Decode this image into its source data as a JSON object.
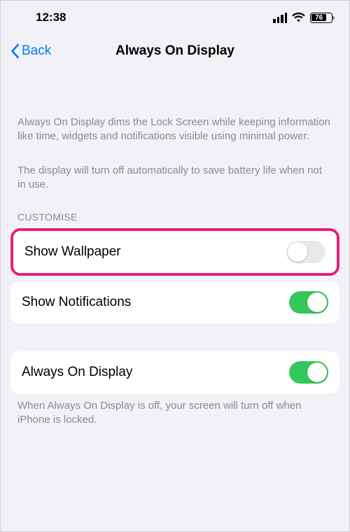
{
  "status": {
    "time": "12:38",
    "battery": "76"
  },
  "nav": {
    "back": "Back",
    "title": "Always On Display"
  },
  "description": {
    "p1": "Always On Display dims the Lock Screen while keeping information like time, widgets and notifications visible using minimal power.",
    "p2": "The display will turn off automatically to save battery life when not in use."
  },
  "sections": {
    "customise": {
      "header": "CUSTOMISE",
      "rows": [
        {
          "label": "Show Wallpaper",
          "on": false
        },
        {
          "label": "Show Notifications",
          "on": true
        }
      ]
    },
    "main": {
      "rows": [
        {
          "label": "Always On Display",
          "on": true
        }
      ],
      "footer": "When Always On Display is off, your screen will turn off when iPhone is locked."
    }
  }
}
